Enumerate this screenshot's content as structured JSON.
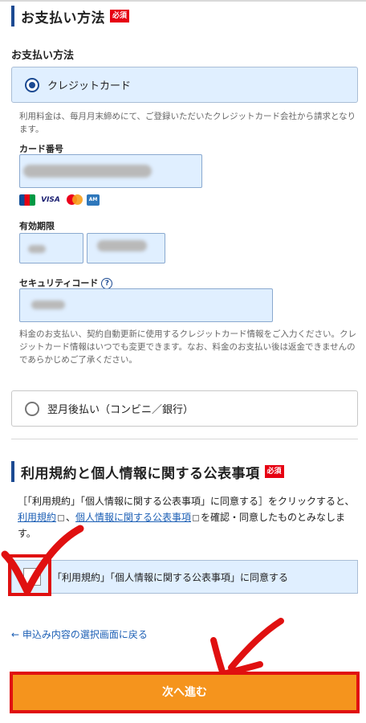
{
  "payment_section": {
    "title": "お支払い方法",
    "required_badge": "必須",
    "method_label": "お支払い方法",
    "credit_option": "クレジットカード",
    "credit_note": "利用料金は、毎月月末締めにて、ご登録いただいたクレジットカード会社から請求となります。",
    "card_number_label": "カード番号",
    "card_brands": [
      "JCB",
      "VISA",
      "Mastercard",
      "AMEX"
    ],
    "expiry_label": "有効期限",
    "security_code_label": "セキュリティコード",
    "help_symbol": "?",
    "card_info_note": "料金のお支払い、契約自動更新に使用するクレジットカード情報をご入力ください。クレジットカード情報はいつでも変更できます。なお、料金のお支払い後は返金できませんのであらかじめご了承ください。",
    "deferred_option": "翌月後払い（コンビニ／銀行）"
  },
  "terms_section": {
    "title": "利用規約と個人情報に関する公表事項",
    "required_badge": "必須",
    "text_before": "［「利用規約」「個人情報に関する公表事項」に同意する］をクリックすると、",
    "terms_link": "利用規約",
    "separator": "、",
    "privacy_link": "個人情報に関する公表事項",
    "text_after": "を確認・同意したものとみなします。",
    "checkbox_label": "「利用規約」「個人情報に関する公表事項」に同意する"
  },
  "navigation": {
    "back_link": "← 申込み内容の選択画面に戻る",
    "next_button": "次へ進む"
  },
  "colors": {
    "accent_blue": "#1c4a92",
    "field_bg": "#e0efff",
    "required_red": "#e60012",
    "next_orange": "#f5941d",
    "annotation_red": "#e01010"
  }
}
